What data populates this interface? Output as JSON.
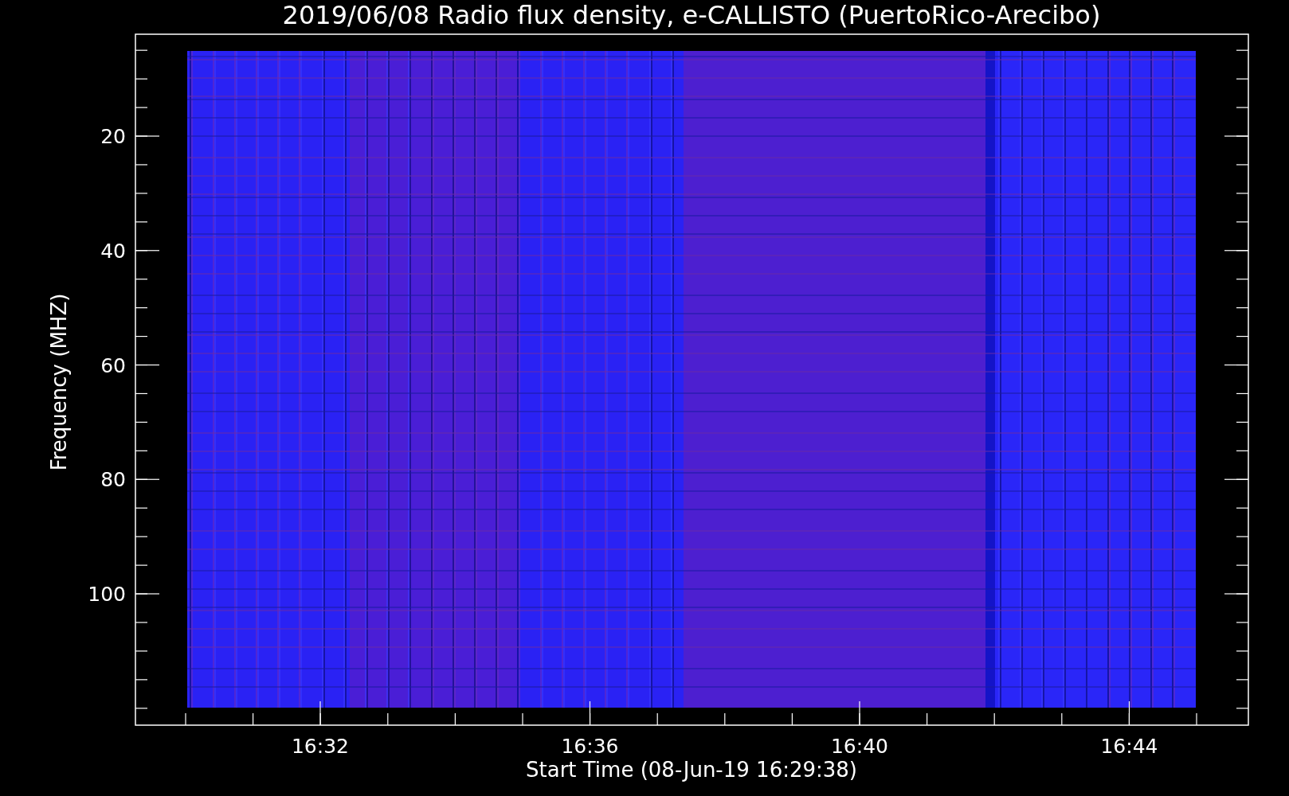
{
  "plot": {
    "title": "2019/06/08  Radio flux density, e-CALLISTO (PuertoRico-Arecibo)",
    "ylabel": "Frequency (MHZ)",
    "xlabel": "Start Time (08-Jun-19 16:29:38)",
    "y_tick_labels": [
      "20",
      "40",
      "60",
      "80",
      "100"
    ],
    "x_tick_labels": [
      "16:32",
      "16:36",
      "16:40",
      "16:44"
    ]
  }
}
